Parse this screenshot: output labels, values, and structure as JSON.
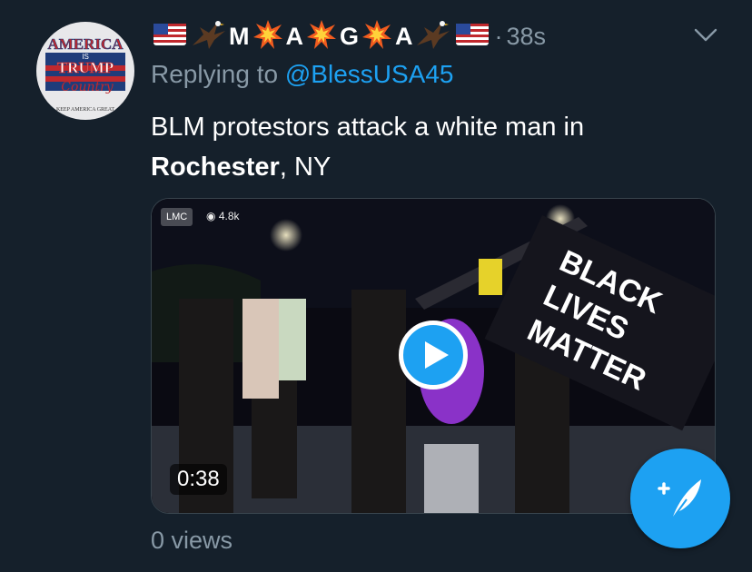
{
  "avatar": {
    "line1": "AMERICA",
    "line2": "IS",
    "line3": "TRUMP",
    "line4": "Country",
    "line5": "KEEP AMERICA GREAT"
  },
  "header": {
    "letters": [
      "M",
      "A",
      "G",
      "A"
    ],
    "separator": "·",
    "time": "38s"
  },
  "reply": {
    "prefix": "Replying to",
    "handle": "@BlessUSA45"
  },
  "tweet": {
    "text_before": "BLM protestors attack a white man in",
    "bold": "Rochester",
    "text_after": ", NY"
  },
  "media": {
    "badge": "LMC",
    "views": "4.8k",
    "duration": "0:38",
    "banner_text": "BLACK LIVES MATTER",
    "play_icon": "play-icon"
  },
  "footer": {
    "view_count": "0 views"
  },
  "colors": {
    "background": "#15202b",
    "accent": "#1da1f2",
    "muted": "#8899a6"
  }
}
